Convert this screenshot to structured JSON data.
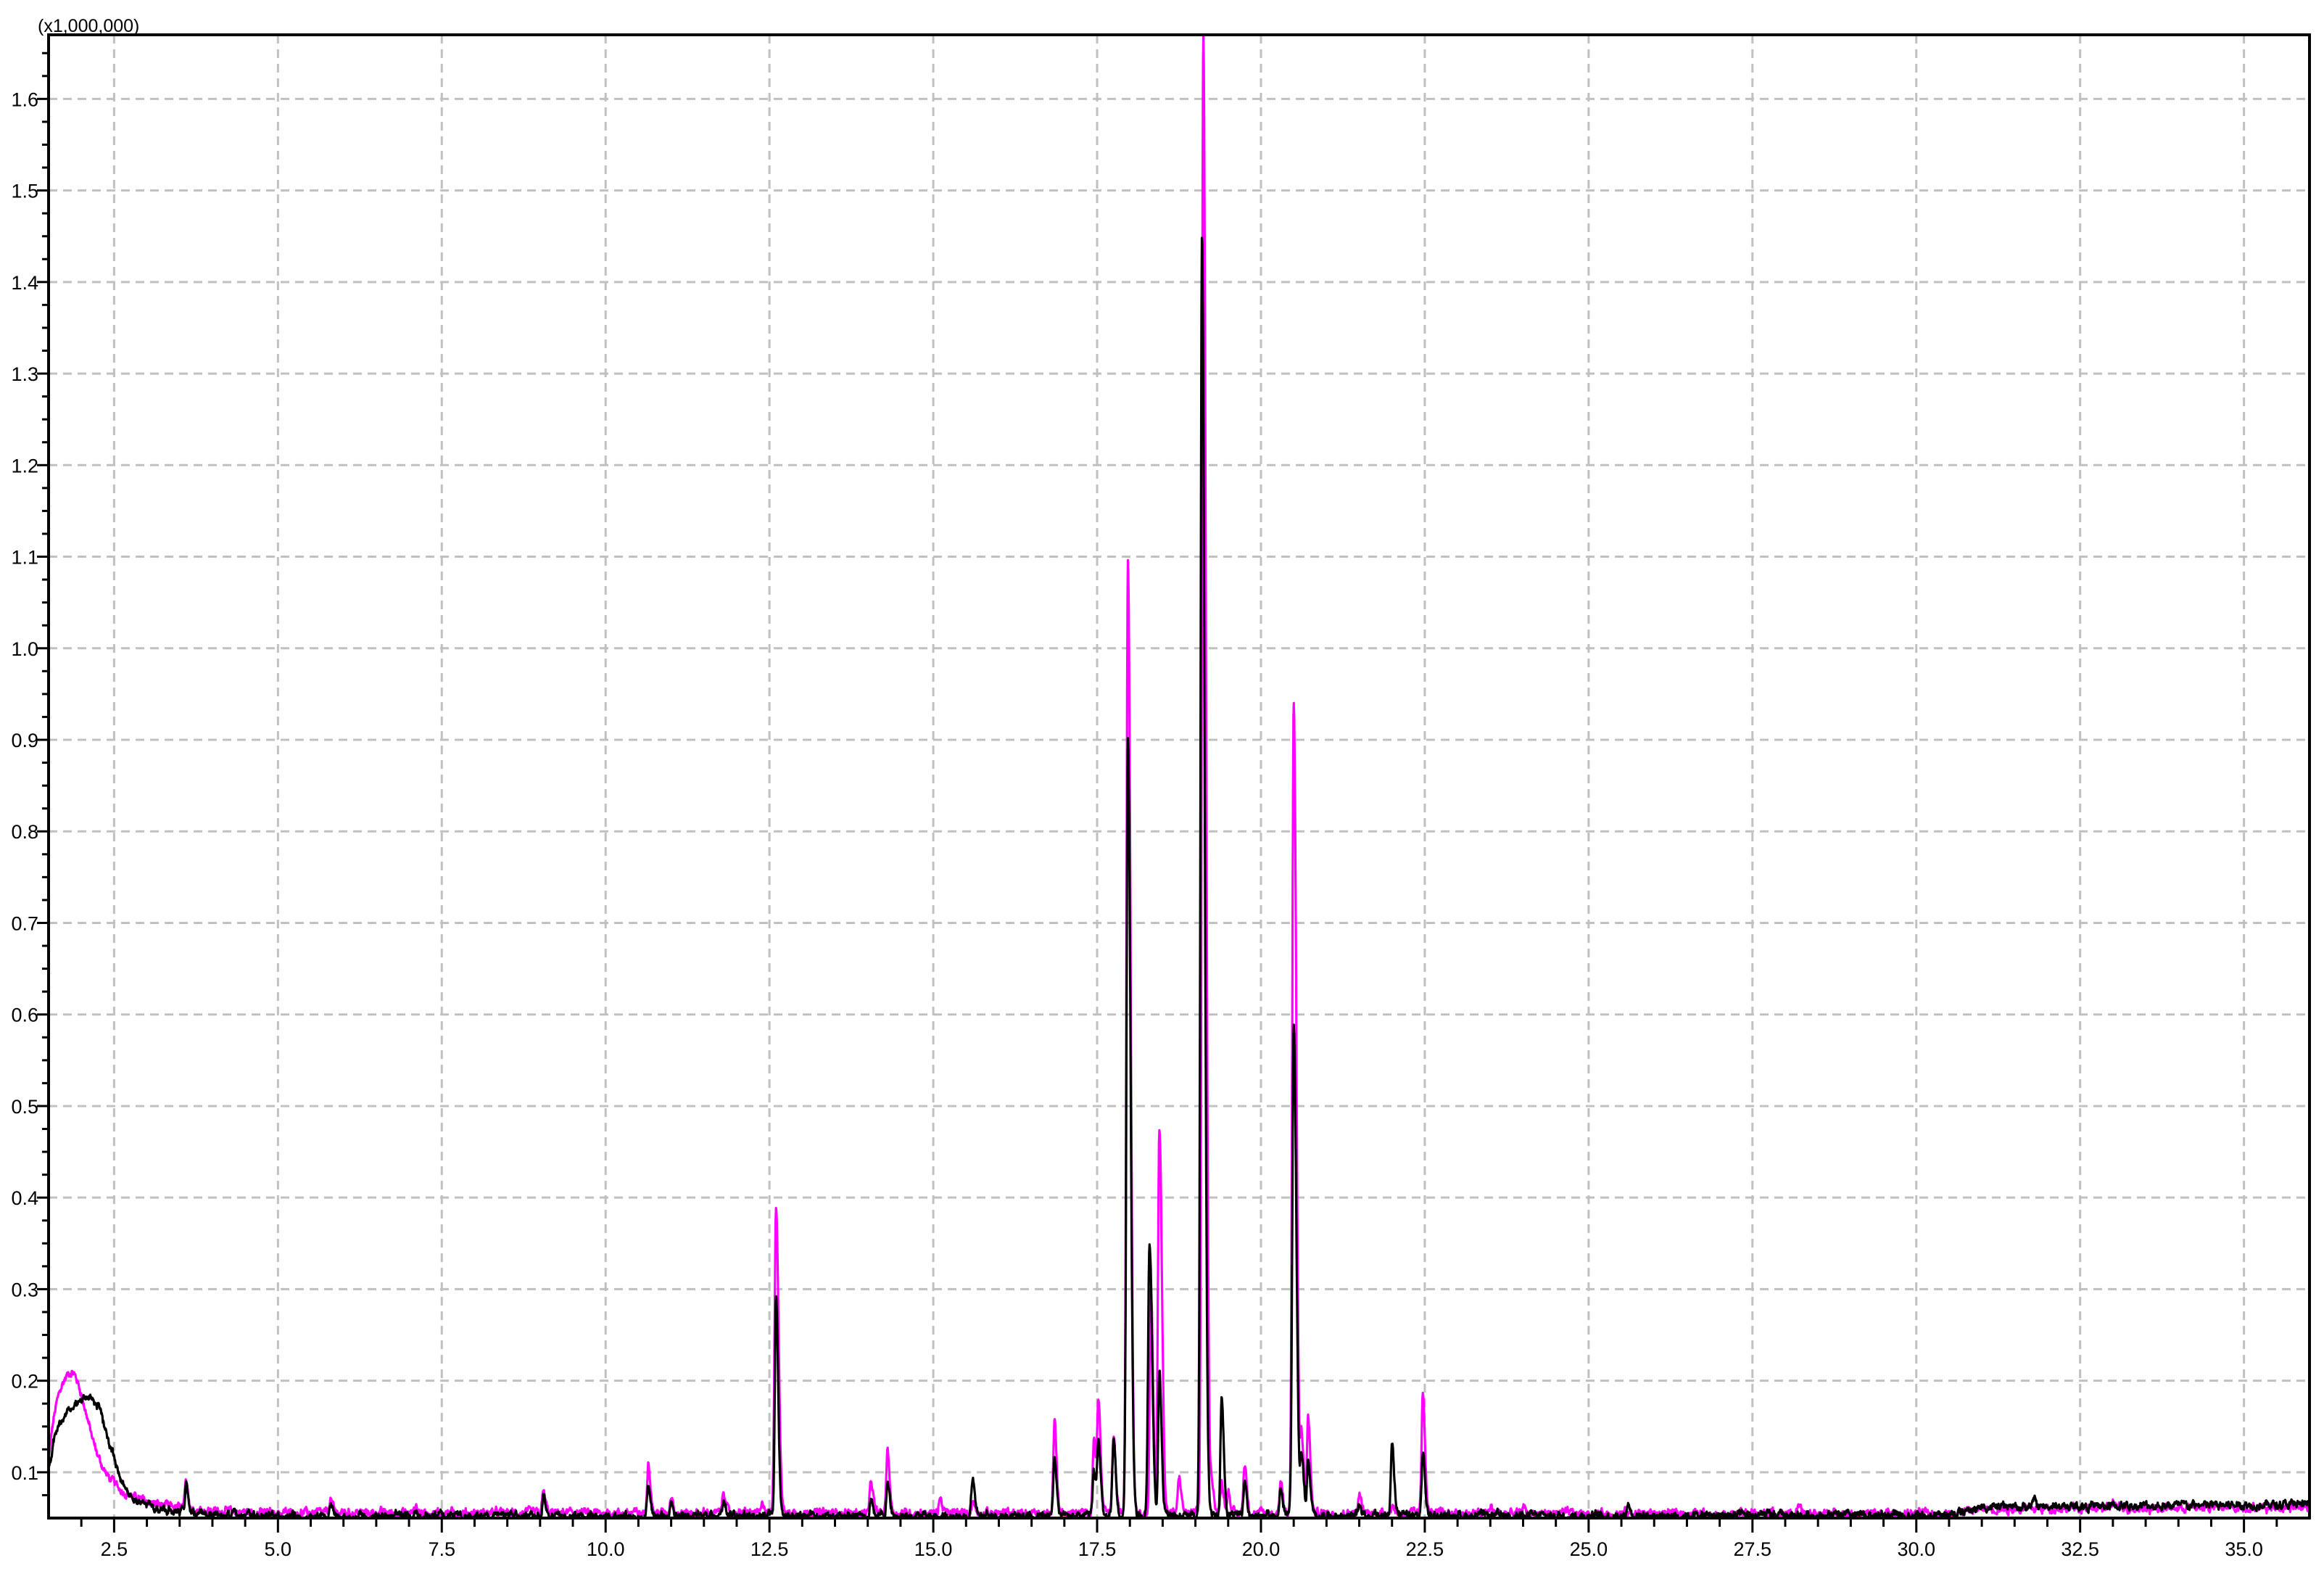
{
  "chart_data": {
    "type": "line",
    "title": "",
    "scale_label": "(x1,000,000)",
    "xlabel": "",
    "ylabel": "",
    "xlim": [
      1.5,
      36.0
    ],
    "ylim": [
      0.05,
      1.67
    ],
    "grid": true,
    "legend": "none",
    "x_ticks": [
      "2.5",
      "5.0",
      "7.5",
      "10.0",
      "12.5",
      "15.0",
      "17.5",
      "20.0",
      "22.5",
      "25.0",
      "27.5",
      "30.0",
      "32.5",
      "35.0"
    ],
    "y_ticks": [
      "0.1",
      "0.2",
      "0.3",
      "0.4",
      "0.5",
      "0.6",
      "0.7",
      "0.8",
      "0.9",
      "1.0",
      "1.1",
      "1.2",
      "1.3",
      "1.4",
      "1.5",
      "1.6"
    ],
    "x_minor_step": 0.5,
    "y_minor_step": 0.025,
    "series": [
      {
        "name": "magenta trace",
        "color": "#ff00ff",
        "baseline": [
          [
            1.5,
            0.056
          ],
          [
            30.5,
            0.055
          ],
          [
            31.0,
            0.06
          ],
          [
            36.0,
            0.062
          ]
        ],
        "hump": {
          "center": 1.8,
          "height": 0.205,
          "start_value": 0.11
        },
        "peaks": [
          [
            3.6,
            0.085
          ],
          [
            5.8,
            0.071
          ],
          [
            7.1,
            0.063
          ],
          [
            9.05,
            0.078
          ],
          [
            10.65,
            0.112
          ],
          [
            11.0,
            0.075
          ],
          [
            11.8,
            0.08
          ],
          [
            12.4,
            0.066
          ],
          [
            12.6,
            0.39
          ],
          [
            14.05,
            0.09
          ],
          [
            14.3,
            0.124
          ],
          [
            15.1,
            0.072
          ],
          [
            15.6,
            0.068
          ],
          [
            16.85,
            0.155
          ],
          [
            17.45,
            0.135
          ],
          [
            17.52,
            0.175
          ],
          [
            17.75,
            0.14
          ],
          [
            17.97,
            1.1
          ],
          [
            18.32,
            0.3
          ],
          [
            18.45,
            0.475
          ],
          [
            18.75,
            0.095
          ],
          [
            19.12,
            1.67
          ],
          [
            19.25,
            0.09
          ],
          [
            19.4,
            0.09
          ],
          [
            19.5,
            0.08
          ],
          [
            19.75,
            0.11
          ],
          [
            20.3,
            0.09
          ],
          [
            20.5,
            0.94
          ],
          [
            20.62,
            0.14
          ],
          [
            20.72,
            0.16
          ],
          [
            21.5,
            0.075
          ],
          [
            22.0,
            0.064
          ],
          [
            22.47,
            0.19
          ],
          [
            23.5,
            0.062
          ],
          [
            24.0,
            0.062
          ],
          [
            28.2,
            0.061
          ],
          [
            33.0,
            0.068
          ]
        ]
      },
      {
        "name": "black trace",
        "color": "#000000",
        "baseline": [
          [
            1.5,
            0.052
          ],
          [
            30.5,
            0.053
          ],
          [
            31.0,
            0.062
          ],
          [
            36.0,
            0.065
          ]
        ],
        "hump": {
          "center": 2.1,
          "height": 0.162,
          "start_value": 0.1
        },
        "peaks": [
          [
            3.6,
            0.083
          ],
          [
            5.8,
            0.066
          ],
          [
            7.1,
            0.058
          ],
          [
            9.05,
            0.073
          ],
          [
            10.65,
            0.085
          ],
          [
            11.0,
            0.066
          ],
          [
            11.8,
            0.07
          ],
          [
            12.6,
            0.29
          ],
          [
            14.05,
            0.07
          ],
          [
            14.3,
            0.09
          ],
          [
            15.6,
            0.092
          ],
          [
            16.85,
            0.115
          ],
          [
            17.45,
            0.1
          ],
          [
            17.52,
            0.13
          ],
          [
            17.75,
            0.14
          ],
          [
            17.97,
            0.9
          ],
          [
            18.3,
            0.35
          ],
          [
            18.45,
            0.21
          ],
          [
            19.1,
            1.45
          ],
          [
            19.4,
            0.185
          ],
          [
            19.75,
            0.09
          ],
          [
            20.3,
            0.08
          ],
          [
            20.5,
            0.59
          ],
          [
            20.62,
            0.12
          ],
          [
            20.72,
            0.11
          ],
          [
            21.5,
            0.065
          ],
          [
            22.0,
            0.135
          ],
          [
            22.47,
            0.12
          ],
          [
            25.6,
            0.066
          ],
          [
            31.8,
            0.07
          ]
        ]
      }
    ]
  }
}
